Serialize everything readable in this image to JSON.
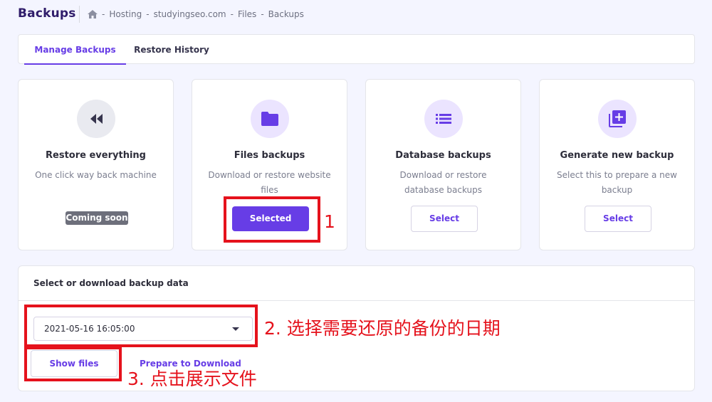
{
  "header": {
    "title": "Backups",
    "breadcrumb": [
      "Hosting",
      "studyingseo.com",
      "Files",
      "Backups"
    ],
    "separator": "-"
  },
  "tabs": [
    {
      "label": "Manage Backups",
      "active": true
    },
    {
      "label": "Restore History",
      "active": false
    }
  ],
  "options": [
    {
      "title": "Restore everything",
      "desc": "One click way back machine",
      "badge": "Coming soon",
      "icon": "rewind-icon"
    },
    {
      "title": "Files backups",
      "desc": "Download or restore website files",
      "button": "Selected",
      "icon": "folder-icon"
    },
    {
      "title": "Database backups",
      "desc": "Download or restore database backups",
      "button": "Select",
      "icon": "list-icon"
    },
    {
      "title": "Generate new backup",
      "desc": "Select this to prepare a new backup",
      "button": "Select",
      "icon": "add-box-icon"
    }
  ],
  "download": {
    "title": "Select or download backup data",
    "selected_date": "2021-05-16 16:05:00",
    "show_files": "Show files",
    "prepare": "Prepare to Download"
  },
  "annotations": {
    "step1": "1",
    "step2": "2. 选择需要还原的备份的日期",
    "step3": "3. 点击展示文件"
  },
  "colors": {
    "accent": "#673de6",
    "annotation": "#e5121c",
    "background": "#f4f5ff"
  }
}
